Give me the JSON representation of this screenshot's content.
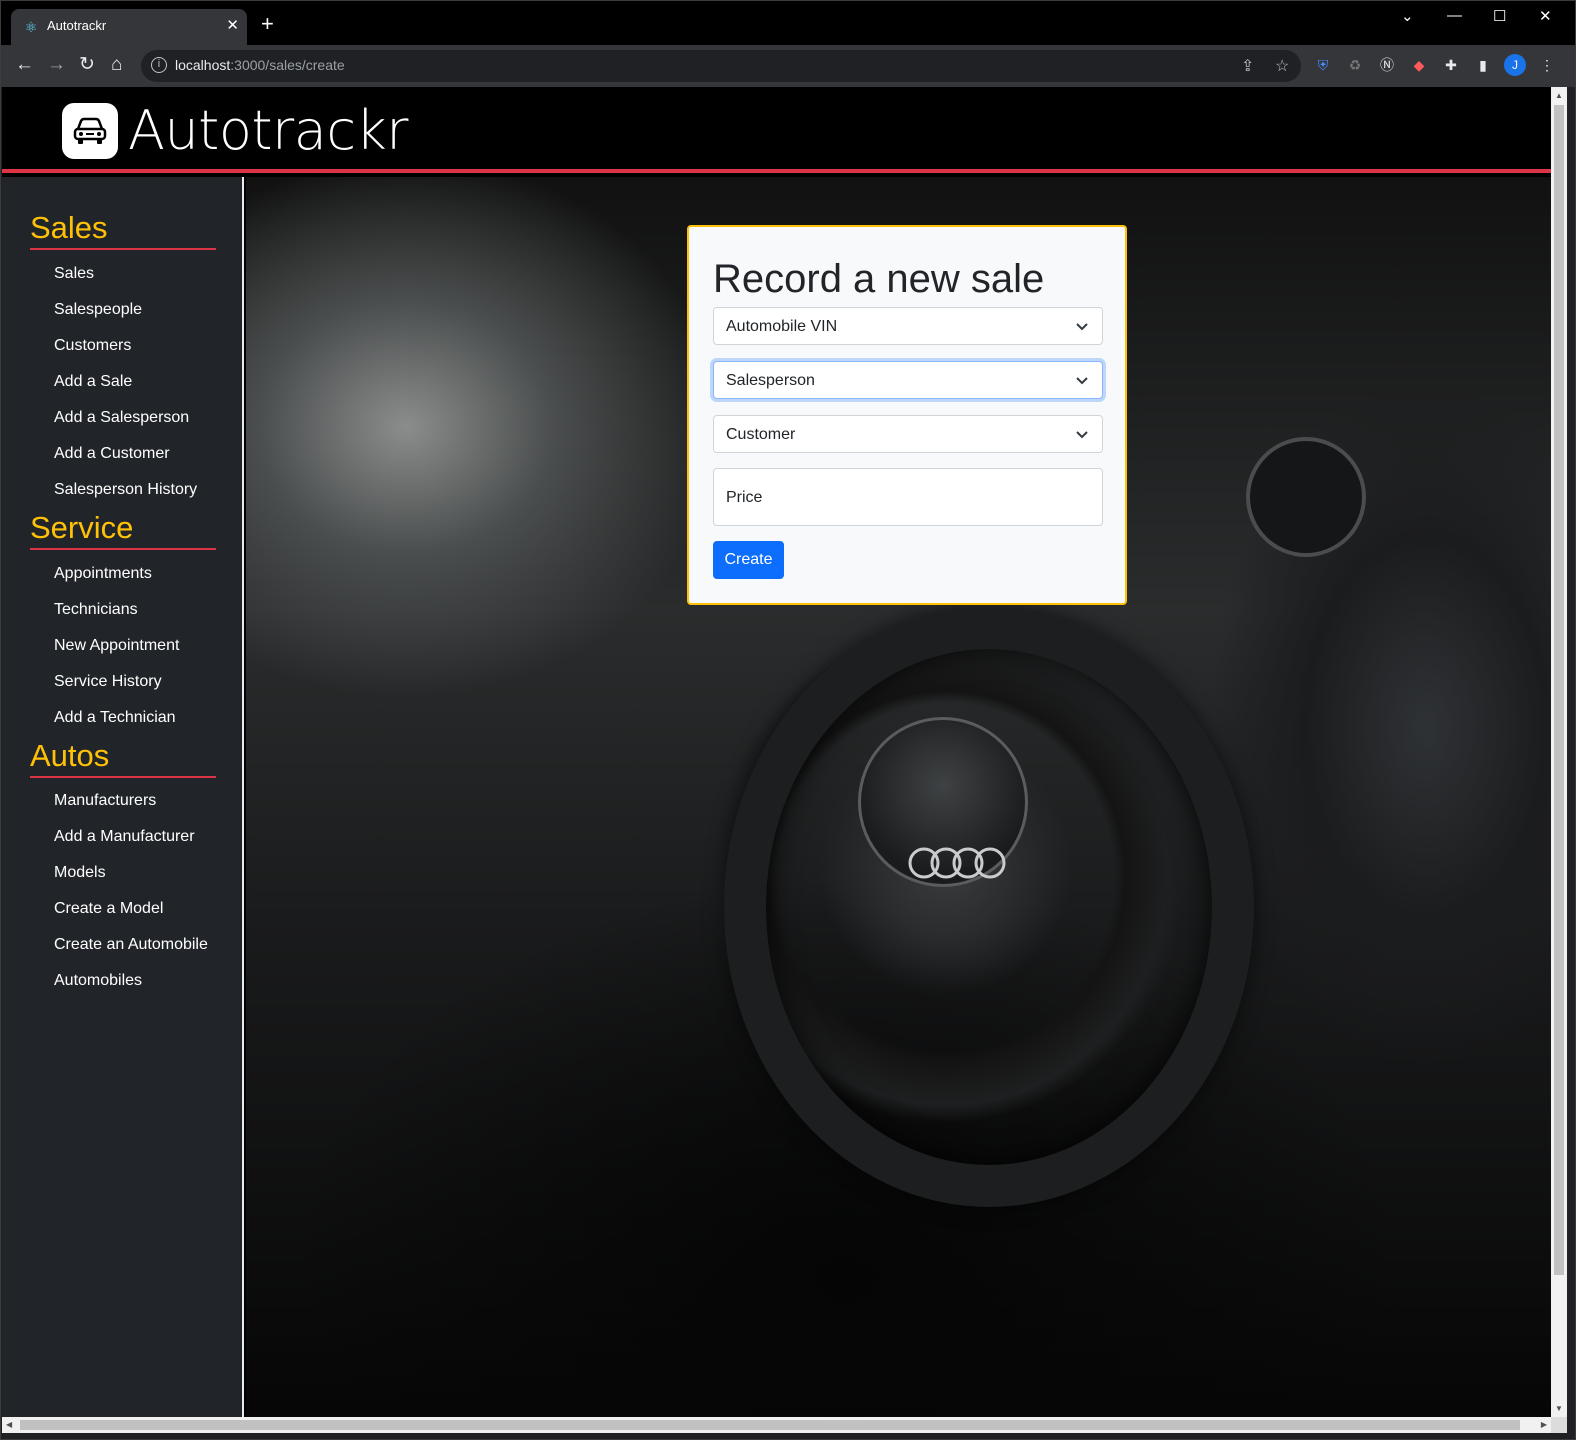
{
  "browser": {
    "tab_title": "Autotrackr",
    "url_host": "localhost",
    "url_path": ":3000/sales/create",
    "profile_initial": "J"
  },
  "app": {
    "brand": "Autotrackr",
    "accent_color": "#dc3545",
    "section_color": "#ffc107"
  },
  "sidebar": {
    "sales": {
      "title": "Sales",
      "items": [
        "Sales",
        "Salespeople",
        "Customers",
        "Add a Sale",
        "Add a Salesperson",
        "Add a Customer",
        "Salesperson History"
      ]
    },
    "service": {
      "title": "Service",
      "items": [
        "Appointments",
        "Technicians",
        "New Appointment",
        "Service History",
        "Add a Technician"
      ]
    },
    "autos": {
      "title": "Autos",
      "items": [
        "Manufacturers",
        "Add a Manufacturer",
        "Models",
        "Create a Model",
        "Create an Automobile",
        "Automobiles"
      ]
    }
  },
  "form": {
    "title": "Record a new sale",
    "automobile_select": "Automobile VIN",
    "salesperson_select": "Salesperson",
    "customer_select": "Customer",
    "price_label": "Price",
    "submit_label": "Create",
    "button_color": "#0d6efd"
  }
}
